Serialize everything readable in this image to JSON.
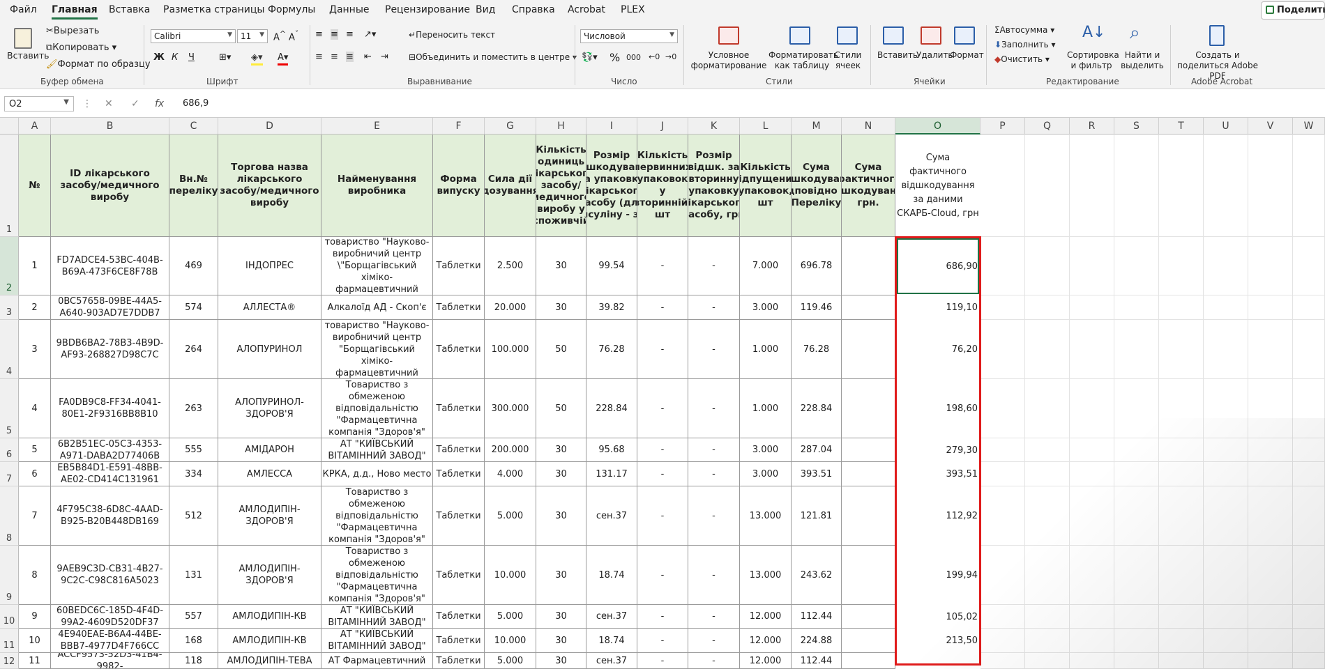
{
  "menu": {
    "tabs": [
      "Файл",
      "Главная",
      "Вставка",
      "Разметка страницы",
      "Формулы",
      "Данные",
      "Рецензирование",
      "Вид",
      "Справка",
      "Acrobat",
      "PLEX"
    ],
    "active": "Главная",
    "share": "Поделиться"
  },
  "ribbon": {
    "clipboard": {
      "paste": "Вставить",
      "cut": "Вырезать",
      "copy": "Копировать",
      "format_painter": "Формат по образцу",
      "label": "Буфер обмена"
    },
    "font": {
      "name": "Calibri",
      "size": "11",
      "bold": "Ж",
      "italic": "К",
      "underline": "Ч",
      "label": "Шрифт"
    },
    "alignment": {
      "wrap": "Переносить текст",
      "merge": "Объединить и поместить в центре",
      "label": "Выравнивание"
    },
    "number": {
      "format": "Числовой",
      "percent": "%",
      "thousands": "000",
      "label": "Число"
    },
    "styles": {
      "conditional": "Условное форматирование",
      "as_table": "Форматировать как таблицу",
      "cell_styles": "Стили ячеек",
      "label": "Стили"
    },
    "cells": {
      "insert": "Вставить",
      "delete": "Удалить",
      "format": "Формат",
      "label": "Ячейки"
    },
    "editing": {
      "autosum": "Автосумма",
      "fill": "Заполнить",
      "clear": "Очистить",
      "sort": "Сортировка и фильтр",
      "find": "Найти и выделить",
      "label": "Редактирование"
    },
    "acrobat": {
      "create": "Создать и поделиться Adobe PDF",
      "label": "Adobe Acrobat"
    }
  },
  "formula_bar": {
    "name_box": "O2",
    "value": "686,9"
  },
  "columns": [
    "A",
    "B",
    "C",
    "D",
    "E",
    "F",
    "G",
    "H",
    "I",
    "J",
    "K",
    "L",
    "M",
    "N",
    "O",
    "P",
    "Q",
    "R",
    "S",
    "T",
    "U",
    "V",
    "W"
  ],
  "row_numbers": [
    "1",
    "2",
    "3",
    "4",
    "5",
    "6",
    "7",
    "8",
    "9",
    "10",
    "11",
    "12"
  ],
  "headers": [
    "№",
    "ID лікарського засобу/медичного виробу",
    "Вн.№ переліку",
    "Торгова назва лікарського засобу/медичного виробу",
    "Найменування виробника",
    "Форма випуску",
    "Сила дії (дозування)",
    "Кількість одиниць лікарського засобу/медичного виробу у споживчій",
    "Розмір відшкодування за упаковку лікарського засобу (для інсуліну - за",
    "Кількість первинних упаковок у вторинній, шт",
    "Розмір відшк. за вторинну упаковку лікарського засобу, грн",
    "Кількість відпущених упаковок, шт",
    "Сума відшкодування відповідно до Переліку",
    "Сума фактичного відшкодування, грн.",
    "Сума фактичного відшкодування за даними СКАРБ-Cloud, грн"
  ],
  "rows": [
    [
      "1",
      "FD7ADCE4-53BC-404B-B69A-473F6CE8F78B",
      "469",
      "ІНДОПРЕС",
      "Публічне акціонерне товариство \"Науково-виробничий центр \\\"Борщагівський хіміко-фармацевтичний завод\"",
      "Таблетки",
      "2.500",
      "30",
      "99.54",
      "-",
      "-",
      "7.000",
      "696.78",
      "",
      "686,90"
    ],
    [
      "2",
      "0BC57658-09BE-44A5-A640-903AD7E7DDB7",
      "574",
      "АЛЛЕСТА®",
      "Алкалоїд АД - Скоп'є",
      "Таблетки",
      "20.000",
      "30",
      "39.82",
      "-",
      "-",
      "3.000",
      "119.46",
      "",
      "119,10"
    ],
    [
      "3",
      "9BDB6BA2-78B3-4B9D-AF93-268827D98C7C",
      "264",
      "АЛОПУРИНОЛ",
      "Публічне акціонерне товариство \"Науково-виробничий центр \"Борщагівський хіміко-фармацевтичний завод\"",
      "Таблетки",
      "100.000",
      "50",
      "76.28",
      "-",
      "-",
      "1.000",
      "76.28",
      "",
      "76,20"
    ],
    [
      "4",
      "FA0DB9C8-FF34-4041-80E1-2F9316BB8B10",
      "263",
      "АЛОПУРИНОЛ-ЗДОРОВ'Я",
      "Товариство з обмеженою відповідальністю \"Фармацевтична компанія \"Здоров'я\"",
      "Таблетки",
      "300.000",
      "50",
      "228.84",
      "-",
      "-",
      "1.000",
      "228.84",
      "",
      "198,60"
    ],
    [
      "5",
      "6B2B51EC-05C3-4353-A971-DABA2D77406B",
      "555",
      "АМІДАРОН",
      "АТ \"КИЇВСЬКИЙ ВІТАМІННИЙ ЗАВОД\"",
      "Таблетки",
      "200.000",
      "30",
      "95.68",
      "-",
      "-",
      "3.000",
      "287.04",
      "",
      "279,30"
    ],
    [
      "6",
      "EB5B84D1-E591-48BB-AE02-CD414C131961",
      "334",
      "АМЛЕССА",
      "КРКА, д.д., Ново место",
      "Таблетки",
      "4.000",
      "30",
      "131.17",
      "-",
      "-",
      "3.000",
      "393.51",
      "",
      "393,51"
    ],
    [
      "7",
      "4F795C38-6D8C-4AAD-B925-B20B448DB169",
      "512",
      "АМЛОДИПІН-ЗДОРОВ'Я",
      "Товариство з обмеженою відповідальністю \"Фармацевтична компанія \"Здоров'я\"",
      "Таблетки",
      "5.000",
      "30",
      "сен.37",
      "-",
      "-",
      "13.000",
      "121.81",
      "",
      "112,92"
    ],
    [
      "8",
      "9AEB9C3D-CB31-4B27-9C2C-C98C816A5023",
      "131",
      "АМЛОДИПІН-ЗДОРОВ'Я",
      "Товариство з обмеженою відповідальністю \"Фармацевтична компанія \"Здоров'я\"",
      "Таблетки",
      "10.000",
      "30",
      "18.74",
      "-",
      "-",
      "13.000",
      "243.62",
      "",
      "199,94"
    ],
    [
      "9",
      "60BEDC6C-185D-4F4D-99A2-4609D520DF37",
      "557",
      "АМЛОДИПІН-КВ",
      "АТ \"КИЇВСЬКИЙ ВІТАМІННИЙ ЗАВОД\"",
      "Таблетки",
      "5.000",
      "30",
      "сен.37",
      "-",
      "-",
      "12.000",
      "112.44",
      "",
      "105,02"
    ],
    [
      "10",
      "4E940EAE-B6A4-44BE-BBB7-4977D4F766CC",
      "168",
      "АМЛОДИПІН-КВ",
      "АТ \"КИЇВСЬКИЙ ВІТАМІННИЙ ЗАВОД\"",
      "Таблетки",
      "10.000",
      "30",
      "18.74",
      "-",
      "-",
      "12.000",
      "224.88",
      "",
      "213,50"
    ],
    [
      "11",
      "ACCF9573-52D3-41B4-9982-",
      "118",
      "АМЛОДИПІН-ТЕВА",
      "АТ Фармацевтичний",
      "Таблетки",
      "5.000",
      "30",
      "сен.37",
      "-",
      "-",
      "12.000",
      "112.44",
      "",
      ""
    ]
  ]
}
